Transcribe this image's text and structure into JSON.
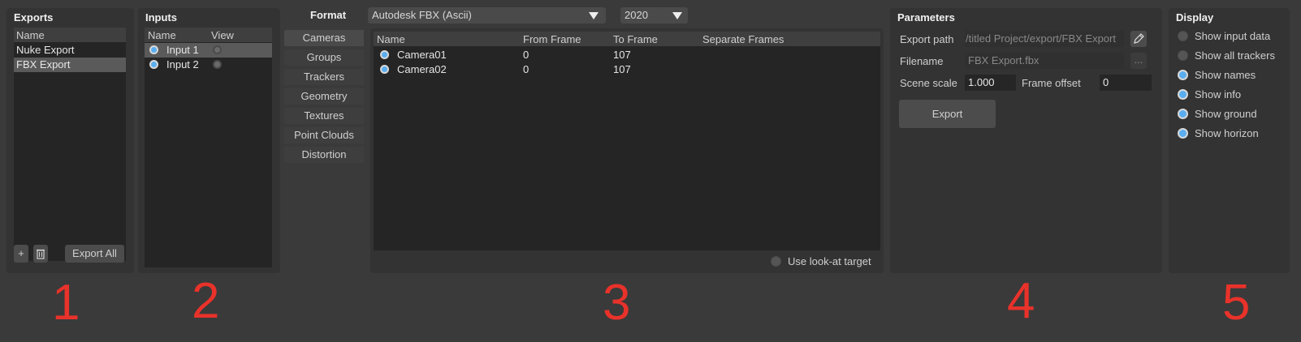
{
  "exports": {
    "title": "Exports",
    "header": "Name",
    "items": [
      "Nuke Export",
      "FBX Export"
    ],
    "add_label": "+",
    "export_all_label": "Export All"
  },
  "inputs": {
    "title": "Inputs",
    "headers": [
      "Name",
      "View"
    ],
    "items": [
      "Input 1",
      "Input 2"
    ]
  },
  "format": {
    "label": "Format",
    "format_value": "Autodesk FBX (Ascii)",
    "version_value": "2020",
    "tabs": [
      "Cameras",
      "Groups",
      "Trackers",
      "Geometry",
      "Textures",
      "Point Clouds",
      "Distortion"
    ],
    "table": {
      "headers": [
        "Name",
        "From Frame",
        "To Frame",
        "Separate Frames"
      ],
      "rows": [
        {
          "name": "Camera01",
          "from": "0",
          "to": "107"
        },
        {
          "name": "Camera02",
          "from": "0",
          "to": "107"
        }
      ]
    },
    "look_at_label": "Use look-at target"
  },
  "parameters": {
    "title": "Parameters",
    "export_path_label": "Export path",
    "export_path_value": "titled Project/export/FBX Export/",
    "filename_label": "Filename",
    "filename_value": "FBX Export.fbx",
    "browse_label": "...",
    "scene_scale_label": "Scene scale",
    "scene_scale_value": "1.000",
    "frame_offset_label": "Frame offset",
    "frame_offset_value": "0",
    "export_label": "Export"
  },
  "display": {
    "title": "Display",
    "options": [
      {
        "label": "Show input data",
        "checked": false
      },
      {
        "label": "Show all trackers",
        "checked": false
      },
      {
        "label": "Show names",
        "checked": true
      },
      {
        "label": "Show info",
        "checked": true
      },
      {
        "label": "Show ground",
        "checked": true
      },
      {
        "label": "Show horizon",
        "checked": true
      }
    ]
  },
  "annotations": [
    "1",
    "2",
    "3",
    "4",
    "5"
  ],
  "colors": {
    "accent": "#5aaef0",
    "annotation": "#e8322a",
    "background": "#3a3a3a"
  }
}
